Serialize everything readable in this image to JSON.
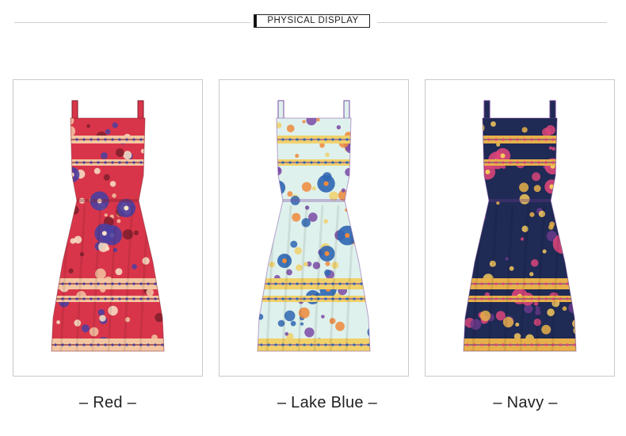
{
  "header": {
    "title": "PHYSICAL DISPLAY"
  },
  "products": [
    {
      "color_label": "– Red –",
      "base": "#d9354a",
      "band": "#f3c6a2",
      "accent": "#4a3fa0",
      "flower": "#f6e4c8",
      "dark": "#7e1f2c"
    },
    {
      "color_label": "– Lake Blue –",
      "base": "#dff1ec",
      "band": "#f0d16a",
      "accent": "#2f66b3",
      "flower": "#f08a3c",
      "dark": "#7a4aa6"
    },
    {
      "color_label": "– Navy –",
      "base": "#1f2a55",
      "band": "#e8b04a",
      "accent": "#d9457a",
      "flower": "#f4c95d",
      "dark": "#6a3a8c"
    }
  ]
}
